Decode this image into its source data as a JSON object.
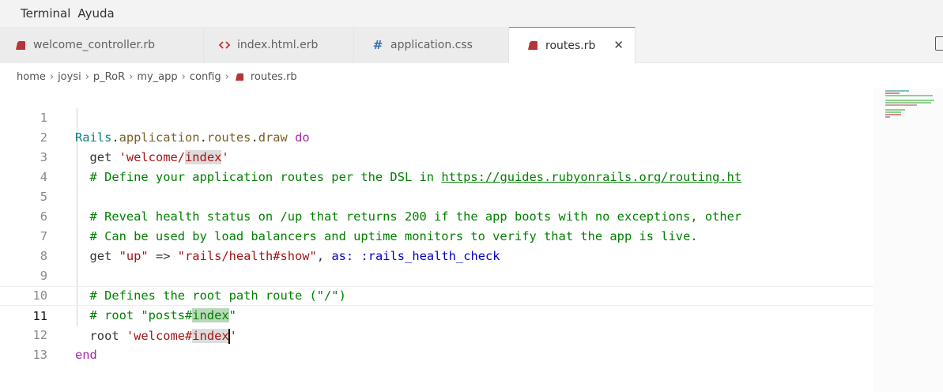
{
  "menu": {
    "items": [
      "Terminal",
      "Ayuda"
    ]
  },
  "tabs": [
    {
      "label": "welcome_controller.rb",
      "icon": "ruby-icon",
      "active": false
    },
    {
      "label": "index.html.erb",
      "icon": "code-icon",
      "active": false
    },
    {
      "label": "application.css",
      "icon": "hash-icon",
      "active": false
    },
    {
      "label": "routes.rb",
      "icon": "ruby-icon",
      "active": true,
      "close": "✕"
    }
  ],
  "breadcrumb": {
    "parts": [
      "home",
      "joysi",
      "p_RoR",
      "my_app",
      "config"
    ],
    "file": "routes.rb",
    "separator": "›"
  },
  "editor": {
    "current_line": 11,
    "lines": [
      {
        "n": "1"
      },
      {
        "n": "2"
      },
      {
        "n": "3"
      },
      {
        "n": "4"
      },
      {
        "n": "5"
      },
      {
        "n": "6"
      },
      {
        "n": "7"
      },
      {
        "n": "8"
      },
      {
        "n": "9"
      },
      {
        "n": "10"
      },
      {
        "n": "11"
      },
      {
        "n": "12"
      },
      {
        "n": "13"
      }
    ],
    "code": {
      "l1": {
        "a": "Rails",
        "b": ".",
        "c": "application",
        "d": ".",
        "e": "routes",
        "f": ".",
        "g": "draw",
        "h": " ",
        "i": "do"
      },
      "l2": {
        "a": "  get ",
        "b": "'welcome/",
        "c": "index",
        "d": "'"
      },
      "l3": {
        "a": "  # Define your application routes per the DSL in ",
        "b": "https://guides.rubyonrails.org/routing.ht"
      },
      "l5": {
        "a": "  # Reveal health status on /up that returns 200 if the app boots with no exceptions, other"
      },
      "l6": {
        "a": "  # Can be used by load balancers and uptime monitors to verify that the app is live."
      },
      "l7": {
        "a": "  get ",
        "b": "\"up\"",
        "c": " => ",
        "d": "\"rails/health#show\"",
        "e": ", ",
        "f": "as:",
        "g": " ",
        "h": ":rails_health_check"
      },
      "l9": {
        "a": "  # Defines the root path route (\"/\")"
      },
      "l10": {
        "a": "  # root \"posts#",
        "b": "index",
        "c": "\""
      },
      "l11": {
        "a": "  root ",
        "b": "'welcome#",
        "c": "index",
        "d": "'"
      },
      "l12": {
        "a": "end"
      }
    }
  },
  "colors": {
    "accent_tab_border": "#3c8fd8",
    "ruby_icon": "#b5343a",
    "comment": "#008000",
    "string": "#a31515",
    "keyword": "#a626a4"
  }
}
